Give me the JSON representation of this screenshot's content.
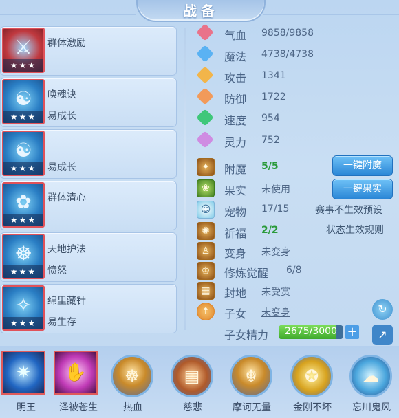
{
  "window": {
    "title": "战备"
  },
  "skills": [
    {
      "name": "群体激励",
      "sub": "",
      "stars": "★★★"
    },
    {
      "name": "唤魂诀",
      "sub": "易成长",
      "stars": "★★★"
    },
    {
      "name": "",
      "sub": "易成长",
      "stars": "★★★"
    },
    {
      "name": "群体清心",
      "sub": "",
      "stars": "★★★"
    },
    {
      "name": "天地护法",
      "sub": "愤怒",
      "stars": "★★★"
    },
    {
      "name": "绵里藏针",
      "sub": "易生存",
      "stars": "★★★"
    }
  ],
  "stats": [
    {
      "label": "气血",
      "value": "9858/9858",
      "icon": "heart-icon",
      "color": "#e0506a"
    },
    {
      "label": "魔法",
      "value": "4738/4738",
      "icon": "magic-icon",
      "color": "#3aa0f0"
    },
    {
      "label": "攻击",
      "value": "1341",
      "icon": "attack-icon",
      "color": "#f2a52a"
    },
    {
      "label": "防御",
      "value": "1722",
      "icon": "defense-icon",
      "color": "#f08a3a"
    },
    {
      "label": "速度",
      "value": "954",
      "icon": "speed-icon",
      "color": "#2fbf6a"
    },
    {
      "label": "灵力",
      "value": "752",
      "icon": "spirit-icon",
      "color": "#c27ad8"
    }
  ],
  "props": [
    {
      "label": "附魔",
      "value": "5/5",
      "style": "green",
      "icon": "enchant-icon"
    },
    {
      "label": "果实",
      "value": "未使用",
      "style": "plain",
      "icon": "fruit-icon"
    },
    {
      "label": "宠物",
      "value": "17/15",
      "style": "plain",
      "icon": "pet-icon"
    },
    {
      "label": "祈福",
      "value": "2/2",
      "style": "green-u",
      "icon": "blessing-icon"
    },
    {
      "label": "变身",
      "value": "未变身",
      "style": "u",
      "icon": "transform-icon"
    },
    {
      "label": "修炼觉醒",
      "value": "6/8",
      "style": "u",
      "icon": "cultivation-icon"
    },
    {
      "label": "封地",
      "value": "未受赏",
      "style": "u",
      "icon": "fief-icon"
    },
    {
      "label": "子女",
      "value": "未变身",
      "style": "u",
      "icon": "child-icon"
    }
  ],
  "child_energy": {
    "label": "子女精力",
    "value": "2675/3000",
    "current": 2675,
    "max": 3000
  },
  "buttons": {
    "enchant": "一键附魔",
    "fruit": "一键果实"
  },
  "links": {
    "preset": "赛事不生效预设",
    "rules": "状态生效规则"
  },
  "bottom_skills": [
    {
      "name": "明王",
      "selected": true
    },
    {
      "name": "泽被苍生",
      "selected": true
    },
    {
      "name": "热血",
      "selected": false
    },
    {
      "name": "慈悲",
      "selected": false
    },
    {
      "name": "摩诃无量",
      "selected": false
    },
    {
      "name": "金刚不坏",
      "selected": false
    },
    {
      "name": "忘川鬼风",
      "selected": false
    }
  ]
}
